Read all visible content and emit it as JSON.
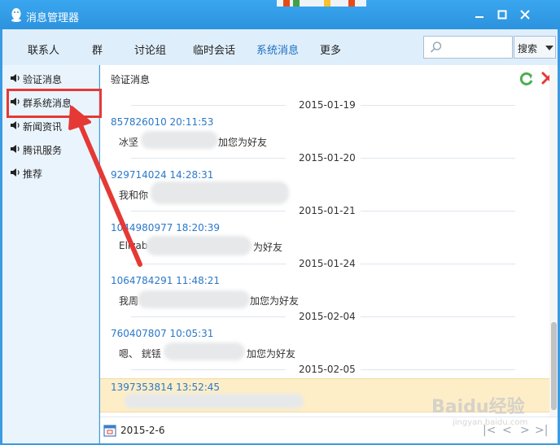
{
  "window": {
    "title": "消息管理器",
    "controls": [
      "minimize",
      "maximize",
      "close"
    ]
  },
  "toolbar": {
    "tabs": [
      {
        "label": "联系人"
      },
      {
        "label": "群"
      },
      {
        "label": "讨论组"
      },
      {
        "label": "临时会话"
      },
      {
        "label": "系统消息",
        "active": true
      },
      {
        "label": "更多"
      }
    ],
    "search": {
      "value": "",
      "placeholder": ""
    },
    "search_button_label": "搜索"
  },
  "sidebar": {
    "items": [
      {
        "label": "验证消息",
        "icon": "speaker-icon"
      },
      {
        "label": "群系统消息",
        "icon": "speaker-icon",
        "highlighted": true
      },
      {
        "label": "新闻资讯",
        "icon": "speaker-icon"
      },
      {
        "label": "腾讯服务",
        "icon": "speaker-icon"
      },
      {
        "label": "推荐",
        "icon": "speaker-icon"
      }
    ]
  },
  "main": {
    "title": "验证消息",
    "messages": [
      {
        "date": "2015-01-19",
        "header": "857826010 20:11:53",
        "body_prefix": "冰坚",
        "body_suffix": "加您为好友"
      },
      {
        "date": "2015-01-20",
        "header": "929714024 14:28:31",
        "body_prefix": "我和你",
        "body_suffix": ""
      },
      {
        "date": "2015-01-21",
        "header": "1044980977 18:20:39",
        "body_prefix": "Elizab",
        "body_suffix": "为好友"
      },
      {
        "date": "2015-01-24",
        "header": "1064784291 11:48:21",
        "body_prefix": "我周",
        "body_suffix": "加您为好友"
      },
      {
        "date": "2015-02-04",
        "header": "760407807 10:05:31",
        "body_prefix": "嗯、 銧铥",
        "body_suffix": "加您为好友"
      },
      {
        "date": "2015-02-05",
        "header": "1397353814 13:52:45",
        "body_prefix": "",
        "body_suffix": "",
        "selected": true
      }
    ]
  },
  "bottom": {
    "date_value": "2015-2-6",
    "pager": [
      "|<",
      "<",
      ">",
      ">|"
    ]
  },
  "watermark": {
    "text": "Baidu经验",
    "sub": "jingyan.baidu.com"
  },
  "colors": {
    "titlebar": "#2c93de",
    "toolbar_bg": "#dfeefb",
    "active_tab": "#1a6fc2",
    "link_blue": "#2a78c9",
    "selected_row": "#fdeec8",
    "annotation_red": "#e53935"
  }
}
